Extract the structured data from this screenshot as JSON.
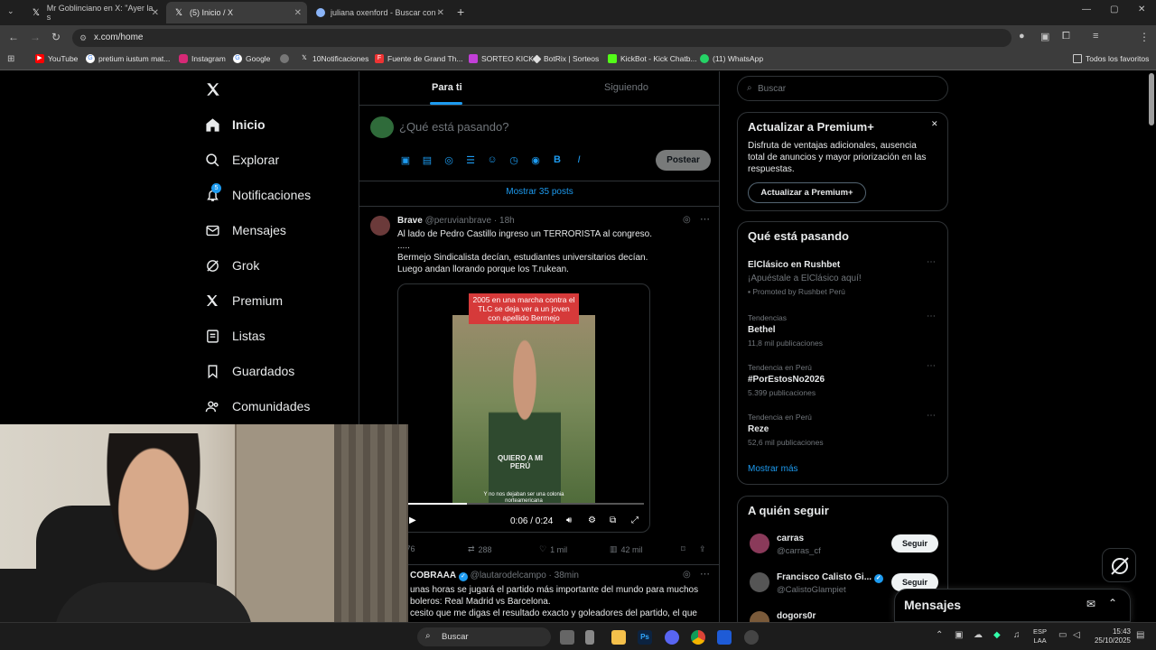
{
  "browser": {
    "tabs": [
      {
        "title": "Mr Goblinciano en X: \"Ayer la s",
        "active": false
      },
      {
        "title": "(5) Inicio / X",
        "active": true
      },
      {
        "title": "juliana oxenford - Buscar con G",
        "active": false
      }
    ],
    "url": "x.com/home",
    "bookmarks": [
      "YouTube",
      "pretium iustum mat...",
      "Instagram",
      "Google",
      "",
      "10Notificaciones",
      "Fuente de Grand Th...",
      "SORTEO KICK",
      "BotRix | Sorteos",
      "KickBot - Kick Chatb...",
      "(11) WhatsApp"
    ],
    "all_bookmarks": "Todos los favoritos"
  },
  "nav": {
    "items": [
      {
        "label": "Inicio",
        "icon": "home-icon"
      },
      {
        "label": "Explorar",
        "icon": "search-icon"
      },
      {
        "label": "Notificaciones",
        "icon": "bell-icon",
        "badge": "5"
      },
      {
        "label": "Mensajes",
        "icon": "mail-icon"
      },
      {
        "label": "Grok",
        "icon": "grok-icon"
      },
      {
        "label": "Premium",
        "icon": "x-logo-icon"
      },
      {
        "label": "Listas",
        "icon": "list-icon"
      },
      {
        "label": "Guardados",
        "icon": "bookmark-icon"
      },
      {
        "label": "Comunidades",
        "icon": "people-icon"
      }
    ]
  },
  "feed": {
    "tab_for_you": "Para ti",
    "tab_following": "Siguiendo",
    "composer_placeholder": "¿Qué está pasando?",
    "post_button": "Postear",
    "show_more": "Mostrar 35 posts",
    "tweet1": {
      "name": "Brave",
      "handle": "@peruvianbrave · 18h",
      "lines": [
        "Al lado de Pedro Castillo ingreso un TERRORISTA al congreso.",
        ".....",
        "Bermejo Sindicalista decían, estudiantes universitarios decían.",
        "Luego andan llorando porque los T.rukean."
      ],
      "video_caption": "2005 en una marcha contra el TLC se deja ver a un joven con apellido Bermejo",
      "shirt_text": "QUIERO A MI PERÚ",
      "subtitle": "Y no nos dejaban ser una colonia norteamericana",
      "time": "0:06 / 0:24",
      "replies": "76",
      "reposts": "288",
      "likes": "1 mil",
      "views": "42 mil"
    },
    "tweet2": {
      "name": "COBRAAA",
      "handle": "@lautarodelcampo · 38min",
      "lines": [
        "unas horas se jugará el partido más importante del mundo para muchos",
        "boleros: Real Madrid vs Barcelona.",
        "cesito que me digas el resultado exacto y goleadores del partido, el que"
      ]
    }
  },
  "right": {
    "search_placeholder": "Buscar",
    "premium": {
      "title": "Actualizar a Premium+",
      "body": [
        "Disfruta de ventajas adicionales, ausencia",
        "total de anuncios y mayor priorización en las",
        "respuestas."
      ],
      "button": "Actualizar a Premium+"
    },
    "trends_title": "Qué está pasando",
    "trends": [
      {
        "meta": "",
        "name": "ElClásico en Rushbet",
        "sub": "¡Apuéstale a ElClásico aquí!",
        "extra": "Promoted by Rushbet Perú"
      },
      {
        "meta": "Tendencias",
        "name": "Bethel",
        "sub": "11,8 mil publicaciones"
      },
      {
        "meta": "Tendencia en Perú",
        "name": "#PorEstosNo2026",
        "sub": "5.399 publicaciones"
      },
      {
        "meta": "Tendencia en Perú",
        "name": "Reze",
        "sub": "52,6 mil publicaciones"
      }
    ],
    "show_more": "Mostrar más",
    "who_to_follow": "A quién seguir",
    "follows": [
      {
        "name": "carras",
        "handle": "@carras_cf",
        "button": "Seguir"
      },
      {
        "name": "Francisco Calisto Gi...",
        "handle": "@CalistoGlampiet",
        "button": "Seguir"
      },
      {
        "name": "dogors0r",
        "handle": "",
        "button": ""
      }
    ],
    "messages": "Mensajes"
  },
  "taskbar": {
    "search": "Buscar",
    "lang": "ESP",
    "lang2": "LAA",
    "time": "15:43",
    "date": "25/10/2025"
  },
  "colors": {
    "accent": "#1d9bf0",
    "bg": "#000000",
    "border": "#2f3336"
  }
}
